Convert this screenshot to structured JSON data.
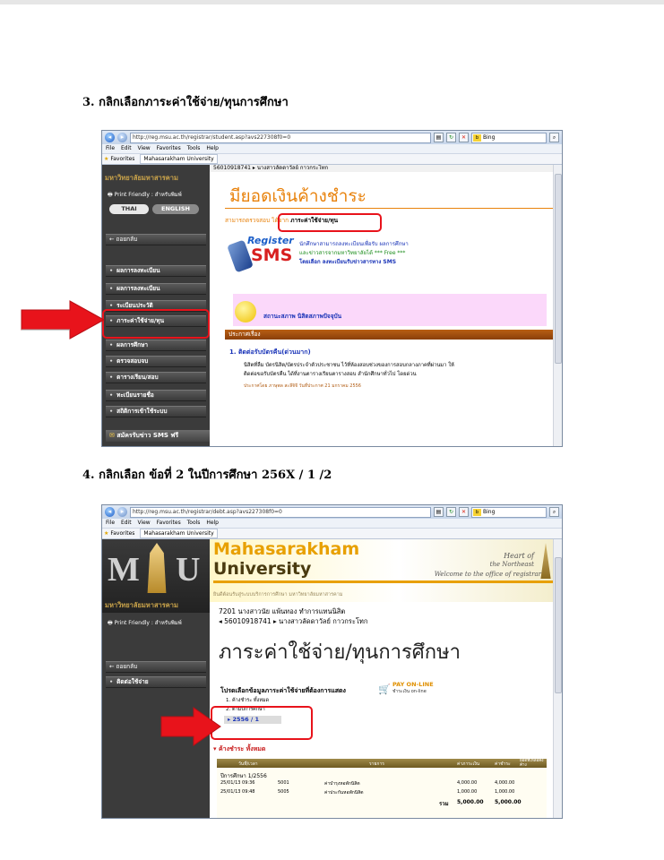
{
  "steps": {
    "s3": "3. กลิกเลือกภาระค่าใช้จ่าย/ทุนการศึกษา",
    "s4": "4. กลิกเลือก ข้อที่ 2 ในปีการศึกษา 256X  / 1 /2"
  },
  "browser": {
    "url1": "http://reg.msu.ac.th/registrar/student.asp?avs227308f0=0",
    "url2": "http://reg.msu.ac.th/registrar/debt.asp?avs227308f0=0",
    "search": "Bing",
    "menu": "File  Edit  View  Favorites  Tools  Help",
    "favorites": "Favorites",
    "tab": "Mahasarakham University"
  },
  "shot1": {
    "topline": "56010918741 ▸ นางสาวลัดดาวัลย์ กาวกระโทก",
    "univ": "มหาวิทยาลัยมหาสารคาม",
    "print": "Print Friendly : สำหรับพิมพ์",
    "thai": "THAI",
    "english": "ENGLISH",
    "back": "← ถอยกลับ",
    "menu1": [
      "ผลการลงทะเบียน",
      "ผลการลงทะเบียน",
      "ระเบียนประวัติ",
      "ภาระค่าใช้จ่าย/ทุน"
    ],
    "menu2": [
      "ผลการศึกษา",
      "ตรวจสอบจบ",
      "ตารางเรียน/สอบ"
    ],
    "menu3": [
      "ทะเบียนรายชื่อ",
      "สถิติการเข้าใช้ระบบ"
    ],
    "sms": "สมัครรับข่าว SMS ฟรี",
    "headline": "มียอดเงินค้างชำระ",
    "sub_prefix": "สามารถตรวจสอบ",
    "sub_mid": "ได้จาก",
    "sub_link": "ภาระค่าใช้จ่าย/ทุน",
    "reg_top": "Register",
    "reg_bot": "SMS",
    "reg1": "นักศึกษาสามารถลงทะเบียนเพื่อรับ ผลการศึกษา",
    "reg2": "และข่าวสารจากมหาวิทยาลัยได้ *** Free ***",
    "reg3": "โดยเลือก ลงทะเบียนรับข่าวสารทาง SMS",
    "status": "สถานะสภาพ นิสิตสภาพปัจจุบัน",
    "news_header": "ประกาศเรื่อง",
    "news_title": "1. ติดต่อรับบัตรคืน(ด่วนมาก)",
    "news_body1": "นิสิตที่ลืม บัตรนิสิต/บัตรประจำตัวประชาชน ไว้ที่ห้องสอบช่วงของการสอบกลางภาคที่ผ่านมา ให้",
    "news_body2": "ติดต่อขอรับบัตรคืน ได้ที่งานตารางเรียนตารางสอบ สำนักศึกษาทั่วไป โดยด่วน",
    "news_meta": "ประกาศโดย ภาษุพล สะลีจิจี  วันที่ประกาศ 21 มกราคม 2556"
  },
  "shot2": {
    "logo_letters": [
      "M",
      "U"
    ],
    "title1": "Mahasarakham",
    "title2": "University",
    "heart1": "Heart of",
    "heart2": "the Northeast",
    "welcome": "Welcome to the office of registrar",
    "tagline": "ยินดีต้อนรับสู่ระบบบริการการศึกษา มหาวิทยาลัยมหาสารคาม",
    "univ": "มหาวิทยาลัยมหาสารคาม",
    "print": "Print Friendly : สำหรับพิมพ์",
    "student1": "7201 นางสาวนัย แพ้นทอง ทำการแทนนิสิต",
    "student2": "◂ 56010918741 ▸ นางสาวลัดดาวัลย์ กาวกระโทก",
    "back": "← ถอยกลับ",
    "menu": "ติดต่อใช้จ่าย",
    "page_title": "ภาระค่าใช้จ่าย/ทุนการศึกษา",
    "prompt": "โปรดเลือกข้อมูลภาระค่าใช้จ่ายที่ต้องการแสดง",
    "payonline": "PAY ON-LINE",
    "payonline_sub": "ชำระเงิน on-line",
    "opt1": "1. ค้างชำระ ทั้งหมด",
    "opt2": "2. ตามปีการศึกษา",
    "year": "▸ 2556 / 1",
    "outstanding": "▾ ค้างชำระ ทั้งหมด",
    "table": {
      "headers": [
        "วันที่/เวลา",
        "",
        "รายการ",
        "ค่าภาระเงิน",
        "ค่าชำระ",
        "ยอดที่เหลือคงค้าง"
      ],
      "group": "ปีการศึกษา 1/2556",
      "rows": [
        [
          "25/01/13 09:36",
          "5001",
          "ค่าบำรุงหอพักนิสิต",
          "4,000.00",
          "4,000.00",
          ""
        ],
        [
          "25/01/13 09:48",
          "5005",
          "ค่าประกันหอพักนิสิต",
          "1,000.00",
          "1,000.00",
          ""
        ]
      ],
      "total_label": "รวม",
      "total_charge": "5,000.00",
      "total_paid": "5,000.00"
    }
  }
}
